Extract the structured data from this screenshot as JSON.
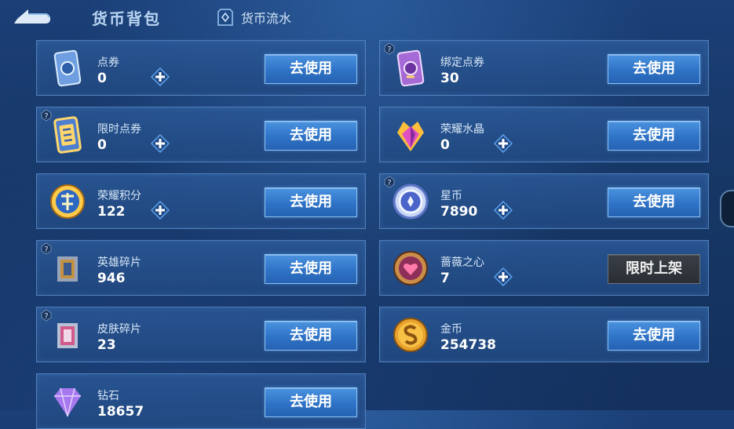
{
  "header": {
    "title": "货币背包",
    "flow_label": "货币流水"
  },
  "cards": [
    {
      "name": "点券",
      "amount": "0",
      "button": "去使用",
      "icon": "coupon-icon",
      "has_plus": true,
      "has_qmark": false,
      "button_style": "blue"
    },
    {
      "name": "绑定点券",
      "amount": "30",
      "button": "去使用",
      "icon": "bound-coupon-icon",
      "has_plus": false,
      "has_qmark": true,
      "button_style": "blue"
    },
    {
      "name": "限时点券",
      "amount": "0",
      "button": "去使用",
      "icon": "limited-coupon-icon",
      "has_plus": true,
      "has_qmark": true,
      "button_style": "blue"
    },
    {
      "name": "荣耀水晶",
      "amount": "0",
      "button": "去使用",
      "icon": "glory-crystal-icon",
      "has_plus": true,
      "has_qmark": false,
      "button_style": "blue"
    },
    {
      "name": "荣耀积分",
      "amount": "122",
      "button": "去使用",
      "icon": "glory-points-icon",
      "has_plus": true,
      "has_qmark": false,
      "button_style": "blue"
    },
    {
      "name": "星币",
      "amount": "7890",
      "button": "去使用",
      "icon": "star-coin-icon",
      "has_plus": true,
      "has_qmark": true,
      "button_style": "blue"
    },
    {
      "name": "英雄碎片",
      "amount": "946",
      "button": "去使用",
      "icon": "hero-fragment-icon",
      "has_plus": false,
      "has_qmark": true,
      "button_style": "blue"
    },
    {
      "name": "蔷薇之心",
      "amount": "7",
      "button": "限时上架",
      "icon": "rose-heart-icon",
      "has_plus": true,
      "has_qmark": false,
      "button_style": "dark"
    },
    {
      "name": "皮肤碎片",
      "amount": "23",
      "button": "去使用",
      "icon": "skin-fragment-icon",
      "has_plus": false,
      "has_qmark": true,
      "button_style": "blue"
    },
    {
      "name": "金币",
      "amount": "254738",
      "button": "去使用",
      "icon": "gold-coin-icon",
      "has_plus": false,
      "has_qmark": false,
      "button_style": "blue"
    },
    {
      "name": "钻石",
      "amount": "18657",
      "button": "去使用",
      "icon": "diamond-icon",
      "has_plus": false,
      "has_qmark": false,
      "button_style": "blue"
    }
  ],
  "colors": {
    "background": "#163766",
    "card_border": "#78aae6",
    "button_blue": "#2f73c6",
    "button_dark": "#2a2e34",
    "title": "#b9d4f2"
  }
}
